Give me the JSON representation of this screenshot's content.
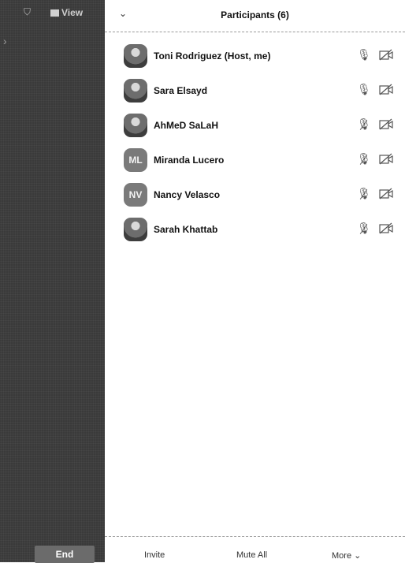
{
  "meeting": {
    "view_label": "View",
    "end_label": "End"
  },
  "participants_panel": {
    "title": "Participants (6)",
    "participants": [
      {
        "name": "Toni Rodriguez (Host, me)",
        "avatar_type": "photo",
        "initials": "",
        "mic": "on",
        "video": "off"
      },
      {
        "name": "Sara Elsayd",
        "avatar_type": "photo",
        "initials": "",
        "mic": "on",
        "video": "off"
      },
      {
        "name": "AhMeD SaLaH",
        "avatar_type": "photo",
        "initials": "",
        "mic": "muted",
        "video": "off"
      },
      {
        "name": "Miranda Lucero",
        "avatar_type": "initials",
        "initials": "ML",
        "mic": "muted",
        "video": "off"
      },
      {
        "name": "Nancy Velasco",
        "avatar_type": "initials",
        "initials": "NV",
        "mic": "muted",
        "video": "off"
      },
      {
        "name": "Sarah Khattab",
        "avatar_type": "photo",
        "initials": "",
        "mic": "muted",
        "video": "off"
      }
    ],
    "footer": {
      "invite_label": "Invite",
      "mute_all_label": "Mute All",
      "more_label": "More"
    }
  }
}
